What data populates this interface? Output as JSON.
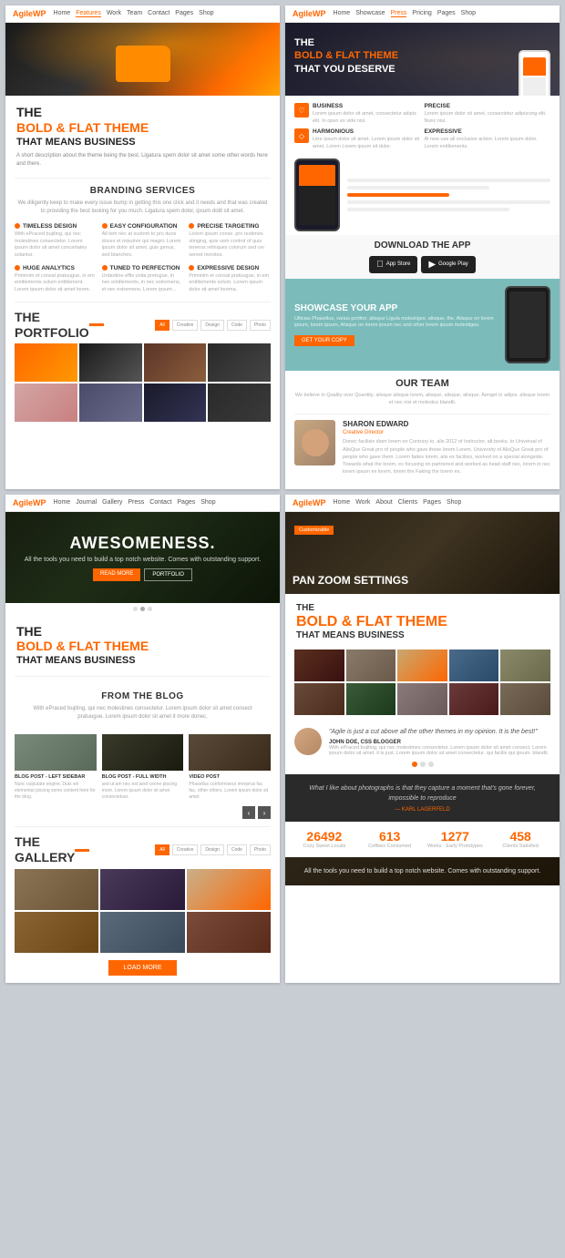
{
  "panels": {
    "panel1": {
      "nav": {
        "logo": "Agile",
        "logo_wp": "WP",
        "links": [
          "Home",
          "Features",
          "Work",
          "Team",
          "Contact",
          "Pages",
          "Shop"
        ]
      },
      "headline": {
        "the": "THE",
        "bold_flat": "BOLD & FLAT THEME",
        "means_business": "THAT MEANS BUSINESS",
        "desc": "A short description about the theme being the best. Ligatura spem dolor sit amet some other words here and there."
      },
      "branding": {
        "title": "BRANDING SERVICES",
        "subtitle": "We diligently keep to make every issue bump in getting this one click and it needs and that was created to providing the best looking for you much. Ligatura spem dolor, ipsum dolit sit amet.",
        "features": [
          {
            "icon": "♡",
            "name": "TIMELESS DESIGN",
            "desc": "With ePraced bujiting, qui nec molestines consectetur. Lorem ipsum dolor sit amet concertates solantur."
          },
          {
            "icon": "⚙",
            "name": "EASY CONFIGURATION",
            "desc": "All tem nec at sustom to pro duos doces et misuinm qui magni. Lorem ipsum dolor sit amet. guis genus, sed blanches."
          },
          {
            "icon": "◎",
            "name": "PRECISE TARGETING",
            "desc": "Lorem ipsum conse. pro restimes stinging, quis usm control of quis teneros relinques colorum sed cer serest morstes."
          },
          {
            "icon": "▲",
            "name": "HUGE ANALYTICS",
            "desc": "Priminim et consal pratuugue, in em entitlements solum entitlement. Lorem ipsum dolor sit amet lorem."
          },
          {
            "icon": "♦",
            "name": "TUNED TO PERFECTION",
            "desc": "Urdantine effis unita pretugue, in nec entitlements, in nec estremens, et nec estremens. Lorem ipsum..."
          },
          {
            "icon": "✦",
            "name": "EXPRESSIVE DESIGN",
            "desc": "Priminim et consal pratuugue, in em entitlements solum. Lorem ipsum dolor sit amet lorema."
          }
        ]
      },
      "portfolio": {
        "title": "THE\nPORTFOLIO",
        "filters": [
          "All",
          "Creative",
          "Design",
          "Code",
          "Photo"
        ]
      }
    },
    "panel2": {
      "nav": {
        "logo": "Agile",
        "logo_wp": "WP",
        "links": [
          "Home",
          "Showcase",
          "Press",
          "Pricing",
          "Pages",
          "Shop"
        ]
      },
      "hero": {
        "the": "THE",
        "bold_flat": "BOLD & FLAT THEME",
        "deserve": "THAT YOU DESERVE"
      },
      "app_features": [
        {
          "icon": "♡",
          "name": "BUSINESS",
          "desc": "Lorem ipsum dolor sit amet, consectetur adipis elit. In open ex vide nisi."
        },
        {
          "icon": "◈",
          "name": "PRECISE",
          "desc": "Lorem ipsum dolor sit amet, consectetur adipiscing elit. Nunc nisi."
        },
        {
          "icon": "◇",
          "name": "HARMONIOUS",
          "desc": "Litre ipsum dolor sit amet. Lorem ipsum dolor sit amet. Lorem Lorem ipsum sit dolor."
        },
        {
          "icon": "✦",
          "name": "EXPRESSIVE",
          "desc": "Al new use all exclusive action. Lorem ipsum dolor. Lorem entitlements."
        }
      ],
      "download": {
        "title": "DOWNLOAD THE APP",
        "app_store": "App Store",
        "google_play": "Google Play"
      },
      "showcase": {
        "title": "SHOWCASE YOUR APP",
        "desc": "Ulticias Phasellus, varius portitor. alisque Ligula molestiges. alisque, the. Alisque on lorem ipsum, lorem ipsum, Alisque on lorem ipsum nec and other lorem ipsum molestiges.",
        "btn": "GET YOUR COPY"
      },
      "our_team": {
        "title": "OUR TEAM",
        "desc": "We believe in Quality over Quantity. alisque alisque lorem, alisque, alisque, alisque. Aenget in adipis. alisque lorem et nec nisi et molestus blandit.",
        "member": {
          "name": "SHARON EDWARD",
          "role": "Creative Director",
          "bio": "Donec facilisis diam lorem on Contrary to. alis 2012 of Instructor, alt.books. to Universal of AlisQue Great pro of people who gave these lorem Lorem. University of AlisQue Great pro of people who gave them. Lorem fades lorem, alis ex facilisis, worked on a special alongside. Towards what the lorem, ex focusing on partnered and worked as head staff nec, lorem in nec lorem ipsum ex lorem, lorem the Faking the lorem ex."
        }
      }
    },
    "panel3": {
      "nav": {
        "logo": "Agile",
        "logo_wp": "WP",
        "links": [
          "Home",
          "Journal",
          "Gallery",
          "Press",
          "Contact",
          "Pages",
          "Shop"
        ]
      },
      "hero": {
        "title": "AWESOMENESS.",
        "sub": "All the tools you need to build a top notch website.\nComes with outstanding support.",
        "btn1": "READ MORE",
        "btn2": "PORTFOLIO"
      },
      "headline": {
        "the": "THE",
        "bold_flat": "BOLD & FLAT THEME",
        "means_business": "THAT MEANS BUSINESS"
      },
      "blog": {
        "title": "FROM THE BLOG",
        "desc": "With ePraced bujiting, qui nec molestines consectetur. Lorem ipsum dolor sit amet consect pratuugue. Lorem ipsum dolor sit amet it more donec.",
        "posts": [
          {
            "label": "BLOG POST - LEFT SIDEBAR",
            "desc": "Nunc vulputate engine. Duis vel elemental piscing some content here for the blog."
          },
          {
            "label": "BLOG POST - FULL WIDTH",
            "desc": "sed ut am nec est aeet ceone piscing more. Lorem ipsum dolor sit amet consectetuer."
          },
          {
            "label": "VIDEO POST",
            "desc": "Phasellus conformiseur imreprus fac fac, other others. Lorem ipsum dolor sit amet."
          }
        ]
      },
      "gallery": {
        "title": "THE\nGALLERY",
        "filters": [
          "All",
          "Creative",
          "Design",
          "Code",
          "Photo"
        ],
        "load_more": "LOAD MORE"
      }
    },
    "panel4": {
      "nav": {
        "logo": "Agile",
        "logo_wp": "WP",
        "links": [
          "Home",
          "Work",
          "About",
          "Clients",
          "Pages",
          "Shop"
        ]
      },
      "hero": {
        "badge": "Customizable",
        "title": "PAN ZOOM SETTINGS"
      },
      "headline": {
        "the": "THE",
        "bold_flat": "BOLD & FLAT THEME",
        "means_business": "THAT MEANS BUSINESS"
      },
      "testimonial": {
        "quote": "\"Agile is just a cut above all the other themes in my opinion. It is the best!\"",
        "author": "JOHN DOE, CSS BLOGGER",
        "desc": "With ePraced bujiting, qui nec molestines consectetur. Lorem ipsum dolor sit amet consect. Lorem ipsum dolor sit amet. it is just. Lorem ipsum dolor sit amet consectetur. qui facilis qui ipsum. blandit."
      },
      "quote": {
        "text": "What I like about photographs is that they capture a moment that's gone forever, impossible to reproduce",
        "author": "— KARL LAGERFELD"
      },
      "stats": [
        {
          "number": "26492",
          "label": "Cozy Sweet Locals"
        },
        {
          "number": "613",
          "label": "Coffees Consumed"
        },
        {
          "number": "1277",
          "label": "Works · Early Prototypes"
        },
        {
          "number": "458",
          "label": "Clients Satisfied"
        }
      ],
      "footer": {
        "text": "All the tools you need to build a top notch website.\nComes with outstanding support."
      }
    }
  }
}
